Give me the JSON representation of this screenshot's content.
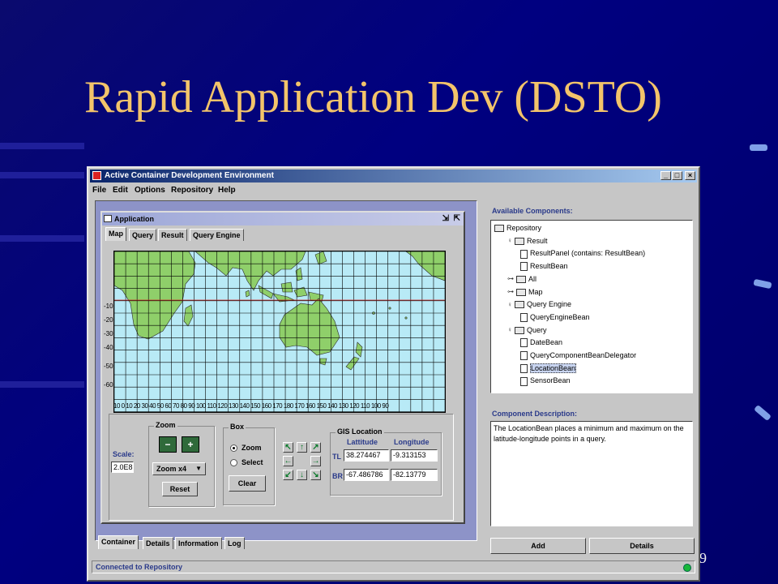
{
  "slide": {
    "title": "Rapid Application Dev (DSTO)",
    "page_number": "9"
  },
  "window": {
    "title": "Active Container Development Environment",
    "menu": [
      "File",
      "Edit",
      "Options",
      "Repository",
      "Help"
    ],
    "status": "Connected to Repository"
  },
  "app": {
    "title": "Application",
    "tabs": [
      "Map",
      "Query",
      "Result",
      "Query Engine"
    ],
    "active_tab": "Map",
    "map": {
      "lat_labels": [
        "-10",
        "-20",
        "-30",
        "-40",
        "-50",
        "-60"
      ],
      "lon_labels": "10 0 10 20 30 40 50 60 70 80 90 100 110 120 130 140 150 160 170 180 170 160 150 140 130 120 110 100 90"
    },
    "zoom": {
      "group": "Zoom",
      "selected": "Zoom x4",
      "reset": "Reset"
    },
    "scale": {
      "label": "Scale:",
      "value": "2.0E8"
    },
    "box": {
      "group": "Box",
      "options": [
        "Zoom",
        "Select"
      ],
      "selected": "Zoom",
      "clear": "Clear"
    },
    "gis": {
      "group": "GIS Location",
      "col_lat": "Lattitude",
      "col_lon": "Longitude",
      "tl_label": "TL",
      "br_label": "BR",
      "tl_lat": "38.274467",
      "tl_lon": "-9.313153",
      "br_lat": "-67.486786",
      "br_lon": "-82.13779"
    }
  },
  "bottom_tabs": [
    "Container",
    "Details",
    "Information",
    "Log"
  ],
  "components": {
    "header": "Available Components:",
    "tree": [
      {
        "label": "Repository",
        "kind": "folder",
        "depth": 0
      },
      {
        "label": "Result",
        "kind": "folder",
        "depth": 1
      },
      {
        "label": "ResultPanel (contains: ResultBean)",
        "kind": "file",
        "depth": 2
      },
      {
        "label": "ResultBean",
        "kind": "file",
        "depth": 2
      },
      {
        "label": "All",
        "kind": "folder",
        "depth": 1
      },
      {
        "label": "Map",
        "kind": "folder",
        "depth": 1
      },
      {
        "label": "Query Engine",
        "kind": "folder",
        "depth": 1
      },
      {
        "label": "QueryEngineBean",
        "kind": "file",
        "depth": 2
      },
      {
        "label": "Query",
        "kind": "folder",
        "depth": 1
      },
      {
        "label": "DateBean",
        "kind": "file",
        "depth": 2
      },
      {
        "label": "QueryComponentBeanDelegator",
        "kind": "file",
        "depth": 2
      },
      {
        "label": "LocationBean",
        "kind": "file",
        "depth": 2
      },
      {
        "label": "SensorBean",
        "kind": "file",
        "depth": 2
      }
    ],
    "selected": "LocationBean",
    "desc_header": "Component Description:",
    "description": "The LocationBean places a minimum and maximum on the latitude-longitude points in a query.",
    "add": "Add",
    "details": "Details"
  },
  "colors": {
    "title": "#f3c46a",
    "background": "#000080",
    "ocean": "#b8eaf6",
    "land": "#8fcf6a"
  }
}
